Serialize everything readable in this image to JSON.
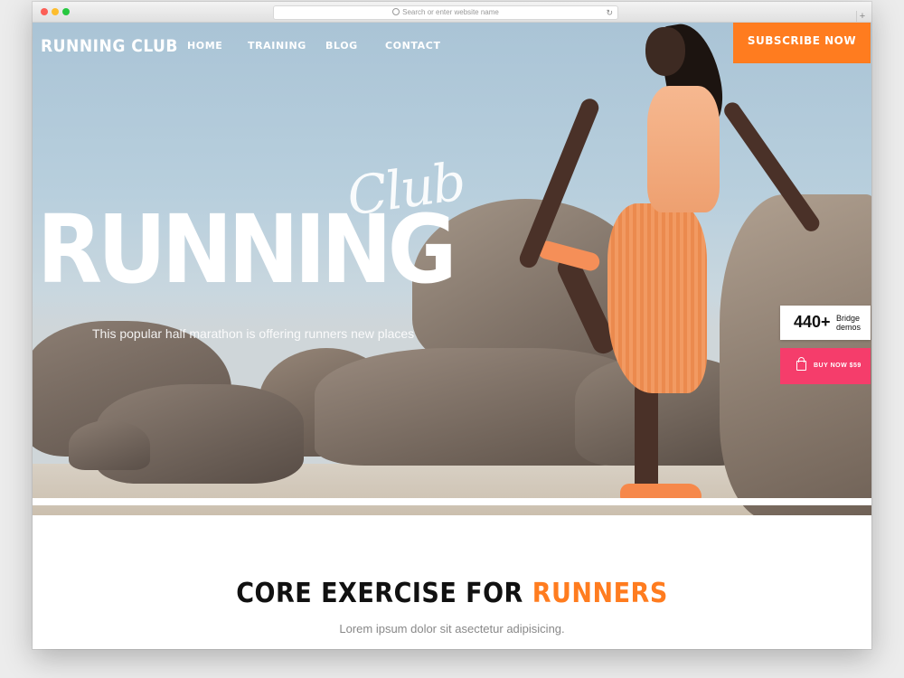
{
  "browser": {
    "url_placeholder": "Search or enter website name",
    "new_tab": "+"
  },
  "nav": {
    "logo": "RUNNING CLUB",
    "links": [
      "HOME",
      "TRAINING",
      "BLOG",
      "CONTACT"
    ],
    "subscribe": "SUBSCRIBE NOW"
  },
  "hero": {
    "script_word": "Club",
    "big_word": "RUNNING",
    "tagline": "This popular half marathon is offering runners new places"
  },
  "badges": {
    "demos_count": "440+",
    "demos_label_1": "Bridge",
    "demos_label_2": "demos",
    "buy_label": "BUY NOW $59"
  },
  "section": {
    "title_main": "CORE EXERCISE FOR ",
    "title_accent": "RUNNERS",
    "subtitle": "Lorem ipsum dolor sit asectetur adipisicing."
  },
  "colors": {
    "accent": "#ff7c1f",
    "buy": "#f53d6b"
  }
}
